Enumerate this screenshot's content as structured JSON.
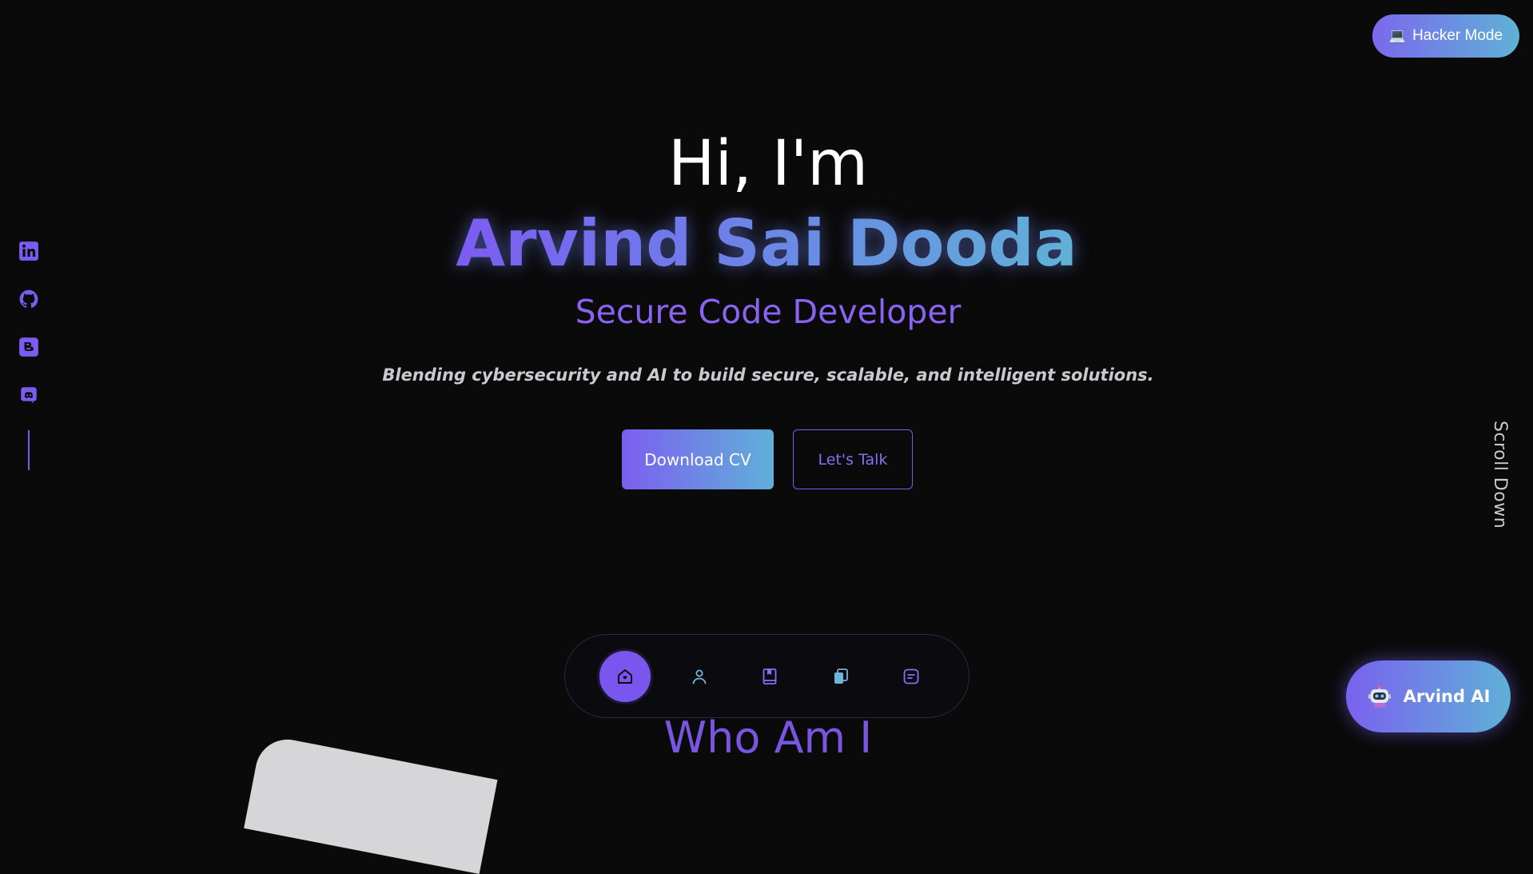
{
  "header": {
    "hacker_mode_icon": "laptop-icon",
    "hacker_mode_label": "Hacker Mode"
  },
  "social": {
    "items": [
      {
        "name": "linkedin",
        "icon": "linkedin-icon"
      },
      {
        "name": "github",
        "icon": "github-icon"
      },
      {
        "name": "blogger",
        "icon": "blogger-icon"
      },
      {
        "name": "discord",
        "icon": "discord-icon"
      }
    ],
    "accent": "#7b5cf0"
  },
  "hero": {
    "greeting": "Hi, I'm",
    "name": "Arvind Sai Dooda",
    "role": "Secure Code Developer",
    "tagline": "Blending cybersecurity and AI to build secure, scalable, and intelligent solutions.",
    "primary_button": "Download CV",
    "secondary_button": "Let's Talk"
  },
  "scroll_hint": "Scroll Down",
  "next_section": {
    "heading": "Who Am I"
  },
  "bottom_nav": {
    "items": [
      {
        "name": "home",
        "icon": "home-icon",
        "active": true
      },
      {
        "name": "about",
        "icon": "user-icon",
        "active": false
      },
      {
        "name": "education",
        "icon": "book-icon",
        "active": false
      },
      {
        "name": "projects",
        "icon": "copy-icon",
        "active": false
      },
      {
        "name": "contact",
        "icon": "message-icon",
        "active": false
      }
    ]
  },
  "chat_button": {
    "icon": "robot-icon",
    "label": "Arvind AI"
  },
  "colors": {
    "background": "#0a0a0b",
    "accent_purple": "#7b5cf0",
    "accent_cyan": "#5fb2d6",
    "text_muted": "#c9c9cf"
  }
}
